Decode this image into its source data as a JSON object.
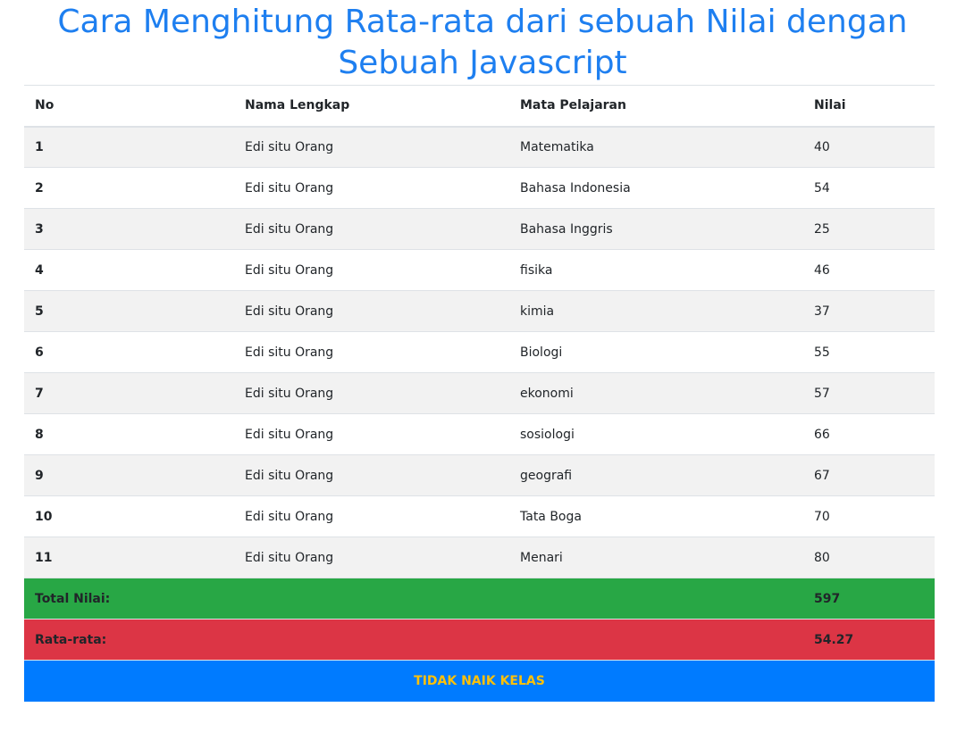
{
  "title": "Cara Menghitung Rata-rata dari sebuah Nilai dengan Sebuah Javascript",
  "table": {
    "headers": {
      "no": "No",
      "name": "Nama Lengkap",
      "subject": "Mata Pelajaran",
      "score": "Nilai"
    },
    "rows": [
      {
        "no": "1",
        "name": "Edi situ Orang",
        "subject": "Matematika",
        "score": "40"
      },
      {
        "no": "2",
        "name": "Edi situ Orang",
        "subject": "Bahasa Indonesia",
        "score": "54"
      },
      {
        "no": "3",
        "name": "Edi situ Orang",
        "subject": "Bahasa Inggris",
        "score": "25"
      },
      {
        "no": "4",
        "name": "Edi situ Orang",
        "subject": "fisika",
        "score": "46"
      },
      {
        "no": "5",
        "name": "Edi situ Orang",
        "subject": "kimia",
        "score": "37"
      },
      {
        "no": "6",
        "name": "Edi situ Orang",
        "subject": "Biologi",
        "score": "55"
      },
      {
        "no": "7",
        "name": "Edi situ Orang",
        "subject": "ekonomi",
        "score": "57"
      },
      {
        "no": "8",
        "name": "Edi situ Orang",
        "subject": "sosiologi",
        "score": "66"
      },
      {
        "no": "9",
        "name": "Edi situ Orang",
        "subject": "geografi",
        "score": "67"
      },
      {
        "no": "10",
        "name": "Edi situ Orang",
        "subject": "Tata Boga",
        "score": "70"
      },
      {
        "no": "11",
        "name": "Edi situ Orang",
        "subject": "Menari",
        "score": "80"
      }
    ]
  },
  "summary": {
    "total_label": "Total Nilai:",
    "total_value": "597",
    "average_label": "Rata-rata:",
    "average_value": "54.27",
    "status": "TIDAK NAIK KELAS"
  },
  "colors": {
    "title": "#1e7ff0",
    "total_row_bg": "#28a745",
    "average_row_bg": "#dc3545",
    "status_row_bg": "#007bff",
    "highlight_text": "#ffc107"
  }
}
